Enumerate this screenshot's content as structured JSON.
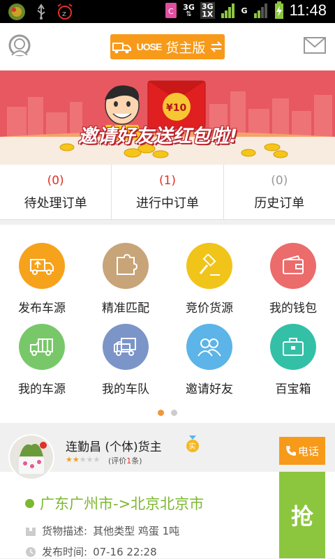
{
  "status_bar": {
    "time": "11:48",
    "network_1": "3G",
    "network_2": "3G",
    "network_2_sub": "1X",
    "network_3": "G"
  },
  "app_bar": {
    "mode_logo": "UOSE",
    "mode_label": "货主版",
    "avatar_icon": "user-avatar-icon",
    "mail_icon": "envelope-icon"
  },
  "banner": {
    "text": "邀请好友送红包啦!",
    "red_packet_amount": "¥10"
  },
  "orders": [
    {
      "count": "(0)",
      "label": "待处理订单",
      "color": "#e0302a"
    },
    {
      "count": "(1)",
      "label": "进行中订单",
      "color": "#e0302a"
    },
    {
      "count": "(0)",
      "label": "历史订单",
      "color": "#999999"
    }
  ],
  "menu": [
    {
      "label": "发布车源",
      "icon": "truck-upload-icon",
      "color": "#f7a21b"
    },
    {
      "label": "精准匹配",
      "icon": "puzzle-icon",
      "color": "#c8a479"
    },
    {
      "label": "竞价货源",
      "icon": "gavel-icon",
      "color": "#f0c419"
    },
    {
      "label": "我的钱包",
      "icon": "wallet-icon",
      "color": "#ec6b6b"
    },
    {
      "label": "我的车源",
      "icon": "truck-icon",
      "color": "#78c86a"
    },
    {
      "label": "我的车队",
      "icon": "fleet-icon",
      "color": "#7b95c8"
    },
    {
      "label": "邀请好友",
      "icon": "friends-icon",
      "color": "#5cb4e8"
    },
    {
      "label": "百宝箱",
      "icon": "toolbox-icon",
      "color": "#33c0a7"
    }
  ],
  "pager": {
    "active_page": 1,
    "page_count": 2
  },
  "listing": {
    "owner_name": "连勤昌 (个体)货主",
    "verified_badge": "实",
    "rating_stars": 2,
    "rating_max": 5,
    "rating_prefix": "(评价",
    "rating_count": "1",
    "rating_suffix": "条)",
    "phone_label": "电话",
    "route": "广东广州市->北京北京市",
    "desc_label": "货物描述:",
    "desc_value": "其他类型  鸡蛋  1吨",
    "time_label": "发布时间:",
    "time_value": "07-16 22:28",
    "grab_label": "抢"
  }
}
